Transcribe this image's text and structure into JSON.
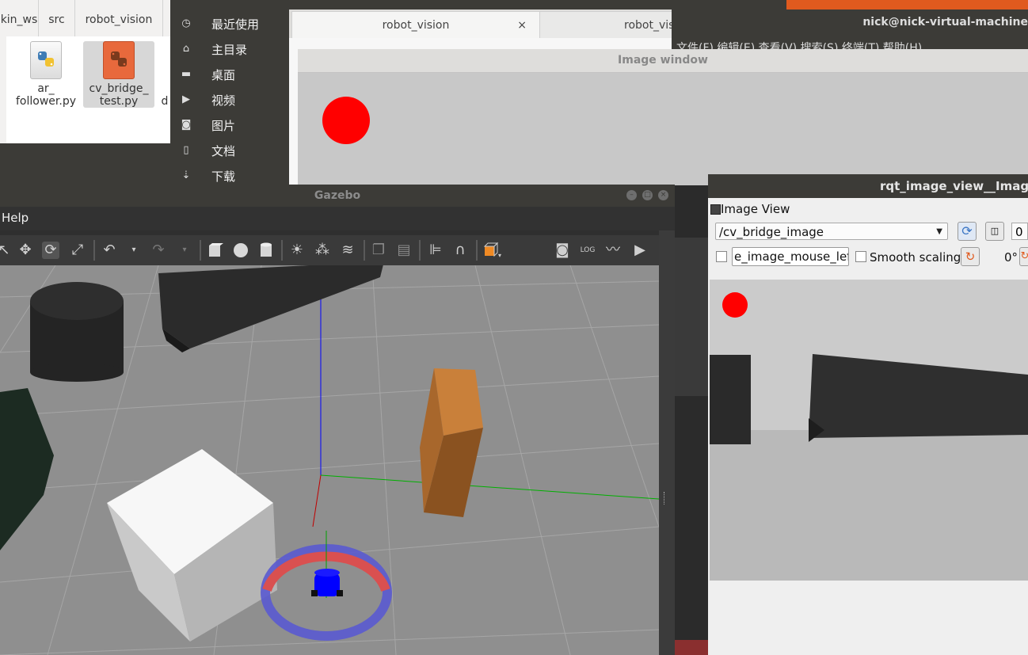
{
  "file_manager": {
    "breadcrumbs": [
      "kin_ws",
      "src",
      "robot_vision"
    ],
    "files": [
      {
        "name_line1": "ar_",
        "name_line2": "follower.py",
        "icon": "python-file-icon"
      },
      {
        "name_line1": "cv_bridge_",
        "name_line2": "test.py",
        "icon": "python-file-icon"
      },
      {
        "name_line1": "d",
        "name_line2": "",
        "icon": "file-icon"
      }
    ],
    "sidebar": [
      {
        "label": "最近使用",
        "icon": "clock-icon"
      },
      {
        "label": "主目录",
        "icon": "home-icon"
      },
      {
        "label": "桌面",
        "icon": "folder-icon"
      },
      {
        "label": "视频",
        "icon": "video-icon"
      },
      {
        "label": "图片",
        "icon": "camera-icon"
      },
      {
        "label": "文档",
        "icon": "document-icon"
      },
      {
        "label": "下载",
        "icon": "download-icon"
      }
    ],
    "tabs": [
      {
        "label": "robot_vision",
        "close": "×"
      },
      {
        "label": "robot_vis"
      }
    ]
  },
  "terminal": {
    "title": "nick@nick-virtual-machine",
    "menu": "文件(F)  编辑(E)  查看(V)  搜索(S)  终端(T)  帮助(H)"
  },
  "image_window": {
    "title": "Image window",
    "circle_color": "#ff0000"
  },
  "gazebo": {
    "title": "Gazebo",
    "menu_help": "Help",
    "toolbar_icons": [
      "select-arrow-icon",
      "translate-icon",
      "rotate-icon",
      "scale-icon",
      "undo-icon",
      "undo-dropdown-icon",
      "redo-icon",
      "redo-dropdown-icon",
      "box-icon",
      "sphere-icon",
      "cylinder-icon",
      "point-light-icon",
      "spot-light-icon",
      "directional-light-icon",
      "copy-icon",
      "paste-icon",
      "align-icon",
      "snap-icon",
      "view-angle-icon",
      "screenshot-icon",
      "log-icon",
      "plot-icon",
      "record-icon"
    ]
  },
  "rqt": {
    "title": "rqt_image_view__ImageVi",
    "dock_label": "Image View",
    "topic": "/cv_bridge_image",
    "topic_number": "0",
    "mouse_topic": "e_image_mouse_left",
    "smooth_label": "Smooth scaling",
    "rotation": "0°"
  },
  "colors": {
    "ubuntu_dark": "#3c3b37",
    "accent_orange": "#e05a1e",
    "red": "#ff0000",
    "blue": "#0000ff"
  }
}
